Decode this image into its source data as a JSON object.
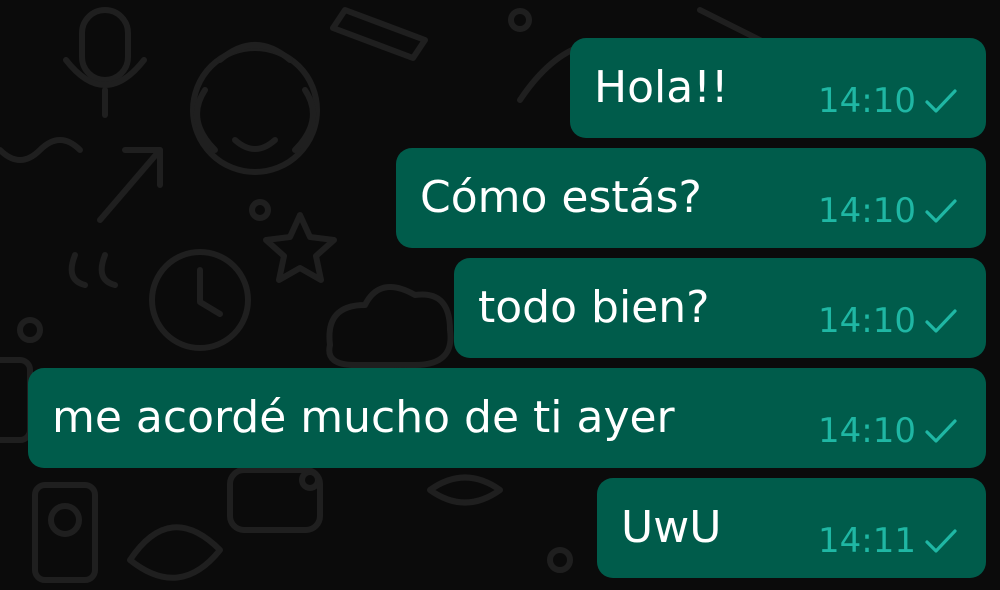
{
  "chat": {
    "colors": {
      "background": "#0b0b0b",
      "bubble_outgoing": "#005c4b",
      "message_text": "#ffffff",
      "meta_text": "#1fb7a4",
      "wallpaper_doodles": "#1f1f1f"
    },
    "messages": [
      {
        "text": "Hola!!",
        "time": "14:10",
        "status_icon": "single-check-icon"
      },
      {
        "text": "Cómo estás?",
        "time": "14:10",
        "status_icon": "single-check-icon"
      },
      {
        "text": "todo bien?",
        "time": "14:10",
        "status_icon": "single-check-icon"
      },
      {
        "text": "me acordé mucho de ti ayer",
        "time": "14:10",
        "status_icon": "single-check-icon"
      },
      {
        "text": "UwU",
        "time": "14:11",
        "status_icon": "single-check-icon"
      }
    ]
  }
}
